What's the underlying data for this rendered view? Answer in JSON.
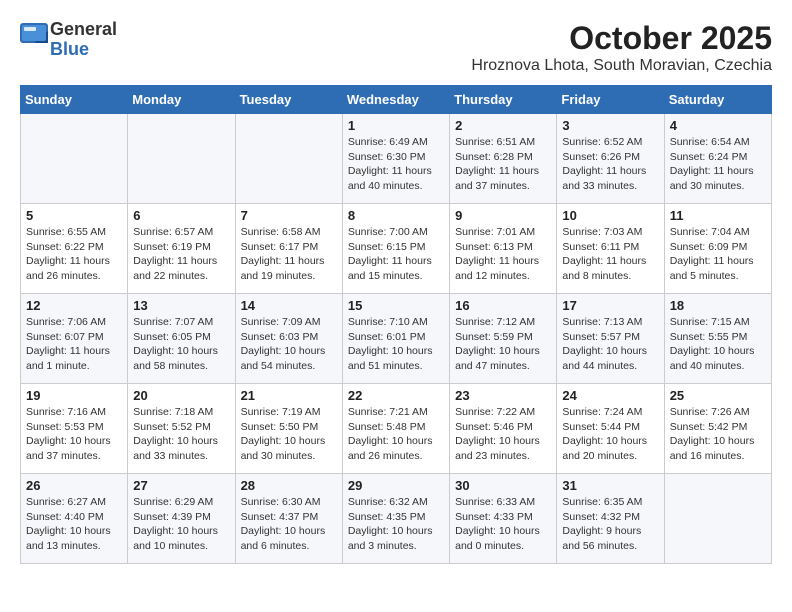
{
  "logo": {
    "general": "General",
    "blue": "Blue"
  },
  "title": "October 2025",
  "subtitle": "Hroznova Lhota, South Moravian, Czechia",
  "weekdays": [
    "Sunday",
    "Monday",
    "Tuesday",
    "Wednesday",
    "Thursday",
    "Friday",
    "Saturday"
  ],
  "weeks": [
    [
      {
        "day": "",
        "info": ""
      },
      {
        "day": "",
        "info": ""
      },
      {
        "day": "",
        "info": ""
      },
      {
        "day": "1",
        "info": "Sunrise: 6:49 AM\nSunset: 6:30 PM\nDaylight: 11 hours\nand 40 minutes."
      },
      {
        "day": "2",
        "info": "Sunrise: 6:51 AM\nSunset: 6:28 PM\nDaylight: 11 hours\nand 37 minutes."
      },
      {
        "day": "3",
        "info": "Sunrise: 6:52 AM\nSunset: 6:26 PM\nDaylight: 11 hours\nand 33 minutes."
      },
      {
        "day": "4",
        "info": "Sunrise: 6:54 AM\nSunset: 6:24 PM\nDaylight: 11 hours\nand 30 minutes."
      }
    ],
    [
      {
        "day": "5",
        "info": "Sunrise: 6:55 AM\nSunset: 6:22 PM\nDaylight: 11 hours\nand 26 minutes."
      },
      {
        "day": "6",
        "info": "Sunrise: 6:57 AM\nSunset: 6:19 PM\nDaylight: 11 hours\nand 22 minutes."
      },
      {
        "day": "7",
        "info": "Sunrise: 6:58 AM\nSunset: 6:17 PM\nDaylight: 11 hours\nand 19 minutes."
      },
      {
        "day": "8",
        "info": "Sunrise: 7:00 AM\nSunset: 6:15 PM\nDaylight: 11 hours\nand 15 minutes."
      },
      {
        "day": "9",
        "info": "Sunrise: 7:01 AM\nSunset: 6:13 PM\nDaylight: 11 hours\nand 12 minutes."
      },
      {
        "day": "10",
        "info": "Sunrise: 7:03 AM\nSunset: 6:11 PM\nDaylight: 11 hours\nand 8 minutes."
      },
      {
        "day": "11",
        "info": "Sunrise: 7:04 AM\nSunset: 6:09 PM\nDaylight: 11 hours\nand 5 minutes."
      }
    ],
    [
      {
        "day": "12",
        "info": "Sunrise: 7:06 AM\nSunset: 6:07 PM\nDaylight: 11 hours\nand 1 minute."
      },
      {
        "day": "13",
        "info": "Sunrise: 7:07 AM\nSunset: 6:05 PM\nDaylight: 10 hours\nand 58 minutes."
      },
      {
        "day": "14",
        "info": "Sunrise: 7:09 AM\nSunset: 6:03 PM\nDaylight: 10 hours\nand 54 minutes."
      },
      {
        "day": "15",
        "info": "Sunrise: 7:10 AM\nSunset: 6:01 PM\nDaylight: 10 hours\nand 51 minutes."
      },
      {
        "day": "16",
        "info": "Sunrise: 7:12 AM\nSunset: 5:59 PM\nDaylight: 10 hours\nand 47 minutes."
      },
      {
        "day": "17",
        "info": "Sunrise: 7:13 AM\nSunset: 5:57 PM\nDaylight: 10 hours\nand 44 minutes."
      },
      {
        "day": "18",
        "info": "Sunrise: 7:15 AM\nSunset: 5:55 PM\nDaylight: 10 hours\nand 40 minutes."
      }
    ],
    [
      {
        "day": "19",
        "info": "Sunrise: 7:16 AM\nSunset: 5:53 PM\nDaylight: 10 hours\nand 37 minutes."
      },
      {
        "day": "20",
        "info": "Sunrise: 7:18 AM\nSunset: 5:52 PM\nDaylight: 10 hours\nand 33 minutes."
      },
      {
        "day": "21",
        "info": "Sunrise: 7:19 AM\nSunset: 5:50 PM\nDaylight: 10 hours\nand 30 minutes."
      },
      {
        "day": "22",
        "info": "Sunrise: 7:21 AM\nSunset: 5:48 PM\nDaylight: 10 hours\nand 26 minutes."
      },
      {
        "day": "23",
        "info": "Sunrise: 7:22 AM\nSunset: 5:46 PM\nDaylight: 10 hours\nand 23 minutes."
      },
      {
        "day": "24",
        "info": "Sunrise: 7:24 AM\nSunset: 5:44 PM\nDaylight: 10 hours\nand 20 minutes."
      },
      {
        "day": "25",
        "info": "Sunrise: 7:26 AM\nSunset: 5:42 PM\nDaylight: 10 hours\nand 16 minutes."
      }
    ],
    [
      {
        "day": "26",
        "info": "Sunrise: 6:27 AM\nSunset: 4:40 PM\nDaylight: 10 hours\nand 13 minutes."
      },
      {
        "day": "27",
        "info": "Sunrise: 6:29 AM\nSunset: 4:39 PM\nDaylight: 10 hours\nand 10 minutes."
      },
      {
        "day": "28",
        "info": "Sunrise: 6:30 AM\nSunset: 4:37 PM\nDaylight: 10 hours\nand 6 minutes."
      },
      {
        "day": "29",
        "info": "Sunrise: 6:32 AM\nSunset: 4:35 PM\nDaylight: 10 hours\nand 3 minutes."
      },
      {
        "day": "30",
        "info": "Sunrise: 6:33 AM\nSunset: 4:33 PM\nDaylight: 10 hours\nand 0 minutes."
      },
      {
        "day": "31",
        "info": "Sunrise: 6:35 AM\nSunset: 4:32 PM\nDaylight: 9 hours\nand 56 minutes."
      },
      {
        "day": "",
        "info": ""
      }
    ]
  ]
}
